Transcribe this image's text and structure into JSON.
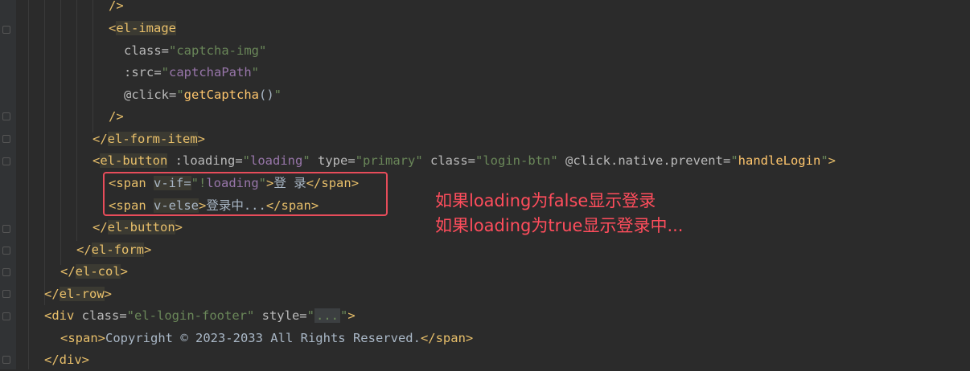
{
  "editor": {
    "lines": [
      {
        "id": "l1",
        "parts": [
          [
            "tag",
            "/>"
          ]
        ]
      },
      {
        "id": "l2",
        "parts": [
          [
            "tag",
            "<"
          ],
          [
            "tagbg",
            "el-image"
          ]
        ]
      },
      {
        "id": "l3",
        "parts": [
          [
            "attr",
            "class="
          ],
          [
            "str",
            "\"captcha-img\""
          ]
        ]
      },
      {
        "id": "l4",
        "parts": [
          [
            "attr",
            ":src="
          ],
          [
            "str",
            "\""
          ],
          [
            "var",
            "captchaPath"
          ],
          [
            "str",
            "\""
          ]
        ]
      },
      {
        "id": "l5",
        "parts": [
          [
            "attr",
            "@click="
          ],
          [
            "str",
            "\""
          ],
          [
            "fn",
            "getCaptcha"
          ],
          [
            "txt",
            "()"
          ],
          [
            "str",
            "\""
          ]
        ]
      },
      {
        "id": "l6",
        "parts": [
          [
            "tag",
            "/>"
          ]
        ]
      },
      {
        "id": "l7",
        "parts": [
          [
            "tag",
            "</"
          ],
          [
            "tagbg",
            "el-form-item"
          ],
          [
            "tag",
            ">"
          ]
        ]
      },
      {
        "id": "l8",
        "parts": [
          [
            "tag",
            "<"
          ],
          [
            "tagbg",
            "el-button"
          ],
          [
            "attr",
            " :loading="
          ],
          [
            "str",
            "\""
          ],
          [
            "var",
            "loading"
          ],
          [
            "str",
            "\""
          ],
          [
            "attr",
            " type="
          ],
          [
            "str",
            "\"primary\""
          ],
          [
            "attr",
            " class="
          ],
          [
            "str",
            "\"login-btn\""
          ],
          [
            "attr",
            " @click.native.prevent="
          ],
          [
            "str",
            "\""
          ],
          [
            "fn",
            "handleLogin"
          ],
          [
            "str",
            "\""
          ],
          [
            "tag",
            ">"
          ]
        ]
      },
      {
        "id": "l9",
        "parts": [
          [
            "tag",
            "<span "
          ],
          [
            "dirbg",
            "v-if="
          ],
          [
            "str",
            "\"!"
          ],
          [
            "var",
            "loading"
          ],
          [
            "str",
            "\""
          ],
          [
            "tag",
            ">"
          ],
          [
            "txt",
            "登 录"
          ],
          [
            "tag",
            "</span>"
          ]
        ]
      },
      {
        "id": "l10",
        "parts": [
          [
            "tag",
            "<span "
          ],
          [
            "dirbg",
            "v-else"
          ],
          [
            "tag",
            ">"
          ],
          [
            "txt",
            "登录中..."
          ],
          [
            "tag",
            "</span>"
          ]
        ]
      },
      {
        "id": "l11",
        "parts": [
          [
            "tag",
            "</"
          ],
          [
            "tagbg",
            "el-button"
          ],
          [
            "tag",
            ">"
          ]
        ]
      },
      {
        "id": "l12",
        "parts": [
          [
            "tag",
            "</"
          ],
          [
            "tagbg",
            "el-form"
          ],
          [
            "tag",
            ">"
          ]
        ]
      },
      {
        "id": "l13",
        "parts": [
          [
            "tag",
            "</"
          ],
          [
            "tagbg",
            "el-col"
          ],
          [
            "tag",
            ">"
          ]
        ]
      },
      {
        "id": "l14",
        "parts": [
          [
            "tag",
            "</"
          ],
          [
            "tagbg",
            "el-row"
          ],
          [
            "tag",
            ">"
          ]
        ]
      },
      {
        "id": "l15",
        "parts": [
          [
            "tag",
            "<div "
          ],
          [
            "attr",
            "class="
          ],
          [
            "str",
            "\"el-login-footer\""
          ],
          [
            "attr",
            " style="
          ],
          [
            "str",
            "\""
          ],
          [
            "ellipsis",
            "..."
          ],
          [
            "str",
            "\""
          ],
          [
            "tag",
            ">"
          ]
        ]
      },
      {
        "id": "l16",
        "parts": [
          [
            "tag",
            "<span>"
          ],
          [
            "txt",
            "Copyright © 2023-2033 All Rights Reserved."
          ],
          [
            "tag",
            "</span>"
          ]
        ]
      },
      {
        "id": "l17",
        "parts": [
          [
            "tag",
            "</div>"
          ]
        ]
      }
    ]
  },
  "annotation": {
    "line1": "如果loading为false显示登录",
    "line2": "如果loading为true显示登录中...",
    "color": "#ff4d5c"
  },
  "icons": {
    "fold_marker": "fold-marker-icon"
  }
}
